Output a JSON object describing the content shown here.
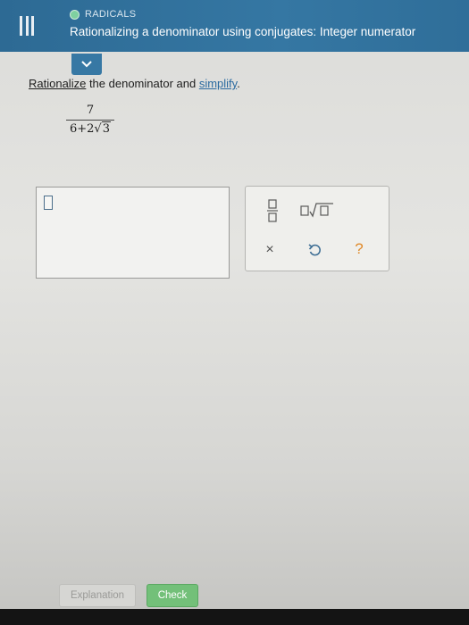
{
  "header": {
    "menu_icon": "menu-icon",
    "topic_label": "RADICALS",
    "lesson_title": "Rationalizing a denominator using conjugates: Integer numerator",
    "color": "#2f6f99"
  },
  "problem": {
    "link_rationalize": "Rationalize",
    "middle_text": " the denominator and ",
    "link_simplify": "simplify",
    "end_text": ".",
    "expression": {
      "numerator": "7",
      "denominator_prefix": "6+2",
      "radicand": "3"
    }
  },
  "answer": {
    "value": ""
  },
  "keypad": {
    "keys": [
      {
        "name": "fraction",
        "icon": "fraction-icon"
      },
      {
        "name": "square-root",
        "icon": "sqrt-icon"
      },
      {
        "name": "clear",
        "label": "×",
        "icon": "close-icon"
      },
      {
        "name": "undo",
        "icon": "undo-icon"
      },
      {
        "name": "help",
        "label": "?",
        "icon": "help-icon"
      }
    ]
  },
  "actions": {
    "explanation_label": "Explanation",
    "check_label": "Check",
    "check_color": "#73c079"
  }
}
